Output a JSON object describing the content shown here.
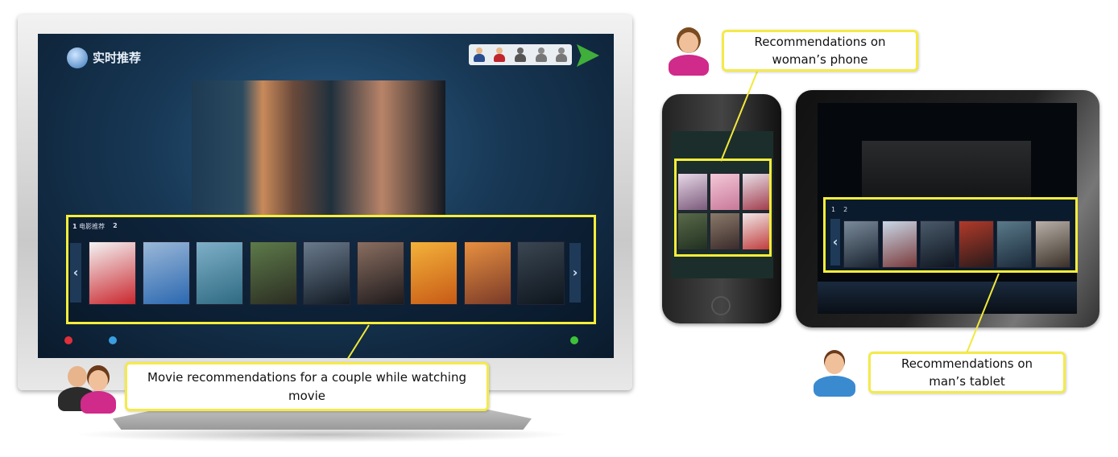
{
  "tv": {
    "title": "实时推荐",
    "tab1_num": "1",
    "tab1_label": "电影推荐",
    "tab2_num": "2",
    "prev_arrow": "‹",
    "next_arrow": "›",
    "users": [
      {
        "icon": "man-user-icon",
        "head": "#e8b88a",
        "body": "#2a4d8f"
      },
      {
        "icon": "woman-user-icon",
        "head": "#e8b88a",
        "body": "#c0262e"
      },
      {
        "icon": "inactive-user-icon",
        "head": "#666",
        "body": "#555"
      },
      {
        "icon": "inactive-user-icon",
        "head": "#888",
        "body": "#777"
      },
      {
        "icon": "inactive-user-icon",
        "head": "#888",
        "body": "#777"
      }
    ],
    "posters": [
      {
        "colors": [
          "#f4f4f4",
          "#c9272e"
        ]
      },
      {
        "colors": [
          "#9bb8d8",
          "#2b68b0"
        ]
      },
      {
        "colors": [
          "#7eb0c8",
          "#2e6a82"
        ]
      },
      {
        "colors": [
          "#5d7a4a",
          "#2b2d22"
        ]
      },
      {
        "colors": [
          "#6a7a8c",
          "#111a24"
        ]
      },
      {
        "colors": [
          "#8a6e60",
          "#1e1a1c"
        ]
      },
      {
        "colors": [
          "#f4b23a",
          "#c75a16"
        ]
      },
      {
        "colors": [
          "#e89040",
          "#7a3a28"
        ]
      },
      {
        "colors": [
          "#3a4652",
          "#0e151d"
        ]
      }
    ],
    "bottom_dots": [
      "#e0303a",
      "#3a9ee0",
      "#3ec23a"
    ]
  },
  "phone": {
    "posters": [
      {
        "colors": [
          "#e8d8e8",
          "#7a5a7a"
        ]
      },
      {
        "colors": [
          "#f4c8d8",
          "#c87898"
        ]
      },
      {
        "colors": [
          "#e8e0e8",
          "#a03a4a"
        ]
      },
      {
        "colors": [
          "#5a6a4a",
          "#203020"
        ]
      },
      {
        "colors": [
          "#8a7a6a",
          "#3a2a2a"
        ]
      },
      {
        "colors": [
          "#f0e8e8",
          "#c03a3a"
        ]
      }
    ]
  },
  "tablet": {
    "tab1_num": "1",
    "tab2_num": "2",
    "prev_arrow": "‹",
    "posters": [
      {
        "colors": [
          "#7a8a9a",
          "#1a2430"
        ]
      },
      {
        "colors": [
          "#c8d8e8",
          "#7a3a3a"
        ]
      },
      {
        "colors": [
          "#4a5a6a",
          "#0e1620"
        ]
      },
      {
        "colors": [
          "#b03a2a",
          "#2a1a1a"
        ]
      },
      {
        "colors": [
          "#5a7a8a",
          "#1a2a3a"
        ]
      },
      {
        "colors": [
          "#b8b0a8",
          "#3a3028"
        ]
      }
    ]
  },
  "callouts": {
    "tv": "Movie recommendations  for a couple  while watching movie",
    "phone": "Recommendations on woman’s phone",
    "tablet": "Recommendations on man’s tablet"
  },
  "colors": {
    "highlight": "#f7ee3a"
  }
}
